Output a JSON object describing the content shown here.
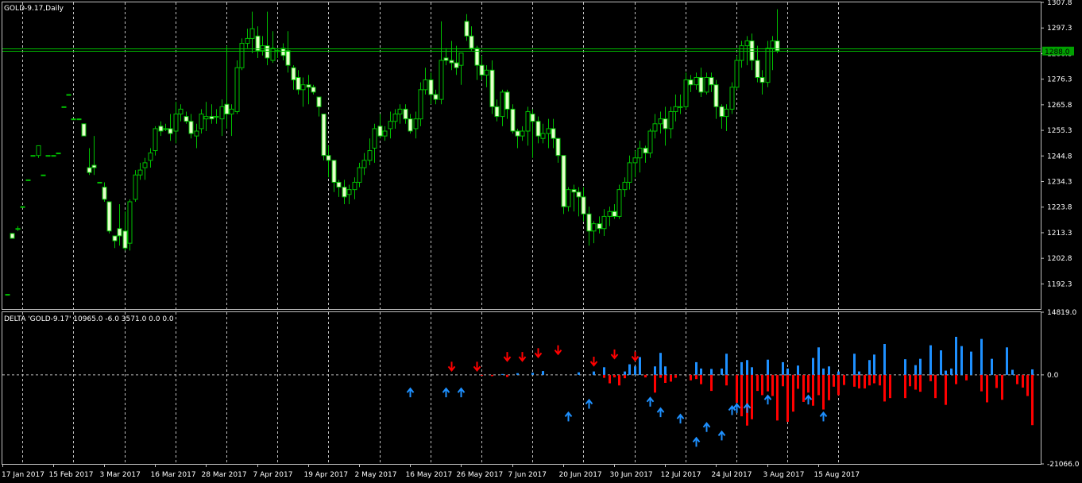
{
  "chart_data": [
    {
      "type": "candlestick",
      "title": "GOLD-9.17,Daily",
      "colors": {
        "background": "#000000",
        "grid": "#c0c0c0",
        "up": "#00c000",
        "body_up": "#000000",
        "body_down": "#e6ffcc",
        "bid_line": "#00c000",
        "price_tag": "#00a000"
      },
      "grid": true,
      "ylim": [
        1182.0,
        1307.8
      ],
      "y_ticks": [
        "1307.8",
        "1297.3",
        "1286.8",
        "1276.3",
        "1265.8",
        "1255.3",
        "1244.8",
        "1234.3",
        "1223.8",
        "1213.3",
        "1202.8",
        "1192.3"
      ],
      "current_price_label": "1288.0",
      "current_price": 1288.0,
      "bid_line": 1289.0,
      "x_ticks": [
        "17 Jan 2017",
        "15 Feb 2017",
        "3 Mar 2017",
        "16 Mar 2017",
        "28 Mar 2017",
        "7 Apr 2017",
        "19 Apr 2017",
        "2 May 2017",
        "16 May 2017",
        "26 May 2017",
        "7 Jun 2017",
        "20 Jun 2017",
        "30 Jun 2017",
        "12 Jul 2017",
        "24 Jul 2017",
        "3 Aug 2017",
        "15 Aug 2017"
      ],
      "candles": [
        [
          1188,
          1188,
          1188,
          1188
        ],
        [
          1213,
          1213,
          1211,
          1211
        ],
        [
          1215,
          1216,
          1214,
          1215
        ],
        [
          1224,
          1224,
          1224,
          1224
        ],
        [
          1235,
          1235,
          1235,
          1235
        ],
        [
          1245,
          1245,
          1245,
          1245
        ],
        [
          1245,
          1249,
          1244,
          1249
        ],
        [
          1237,
          1237,
          1237,
          1237
        ],
        [
          1245,
          1245,
          1245,
          1245
        ],
        [
          1245,
          1245,
          1245,
          1245
        ],
        [
          1246,
          1246,
          1246,
          1246
        ],
        [
          1265,
          1265,
          1265,
          1265
        ],
        [
          1270,
          1270,
          1270,
          1270
        ],
        [
          1260,
          1260,
          1260,
          1260
        ],
        [
          1260,
          1260,
          1260,
          1260
        ],
        [
          1258,
          1258,
          1253,
          1253
        ],
        [
          1240,
          1248,
          1237,
          1238
        ],
        [
          1241,
          1253,
          1237,
          1240
        ],
        [
          1234,
          1234,
          1234,
          1234
        ],
        [
          1232,
          1234,
          1226,
          1227
        ],
        [
          1226,
          1226,
          1213,
          1214
        ],
        [
          1212,
          1212,
          1207,
          1210
        ],
        [
          1215,
          1225,
          1208,
          1212
        ],
        [
          1214,
          1222,
          1206,
          1207
        ],
        [
          1209,
          1227,
          1206,
          1226
        ],
        [
          1227,
          1239,
          1226,
          1237
        ],
        [
          1237,
          1242,
          1235,
          1239
        ],
        [
          1240,
          1244,
          1235,
          1242
        ],
        [
          1243,
          1248,
          1240,
          1246
        ],
        [
          1247,
          1257,
          1245,
          1256
        ],
        [
          1257,
          1259,
          1253,
          1255
        ],
        [
          1256,
          1258,
          1255,
          1256
        ],
        [
          1256,
          1262,
          1251,
          1254
        ],
        [
          1255,
          1267,
          1250,
          1262
        ],
        [
          1262,
          1266,
          1259,
          1264
        ],
        [
          1261,
          1263,
          1258,
          1259
        ],
        [
          1259,
          1262,
          1252,
          1254
        ],
        [
          1253,
          1258,
          1248,
          1255
        ],
        [
          1256,
          1264,
          1254,
          1262
        ],
        [
          1260,
          1267,
          1255,
          1261
        ],
        [
          1261,
          1266,
          1258,
          1260
        ],
        [
          1261,
          1264,
          1258,
          1261
        ],
        [
          1260,
          1268,
          1253,
          1265
        ],
        [
          1266,
          1290,
          1256,
          1262
        ],
        [
          1262,
          1266,
          1253,
          1264
        ],
        [
          1263,
          1284,
          1262,
          1281
        ],
        [
          1281,
          1293,
          1280,
          1291
        ],
        [
          1291,
          1297,
          1289,
          1293
        ],
        [
          1293,
          1304,
          1287,
          1297
        ],
        [
          1294,
          1298,
          1285,
          1288
        ],
        [
          1288,
          1294,
          1286,
          1290
        ],
        [
          1290,
          1304,
          1282,
          1285
        ],
        [
          1284,
          1296,
          1283,
          1289
        ],
        [
          1288,
          1289,
          1285,
          1288
        ],
        [
          1289,
          1291,
          1284,
          1286
        ],
        [
          1288,
          1296,
          1279,
          1282
        ],
        [
          1281,
          1282,
          1272,
          1276
        ],
        [
          1277,
          1280,
          1270,
          1272
        ],
        [
          1272,
          1277,
          1265,
          1274
        ],
        [
          1274,
          1278,
          1266,
          1273
        ],
        [
          1273,
          1274,
          1270,
          1271
        ],
        [
          1269,
          1269,
          1261,
          1265
        ],
        [
          1262,
          1262,
          1243,
          1245
        ],
        [
          1245,
          1249,
          1236,
          1243
        ],
        [
          1243,
          1243,
          1230,
          1234
        ],
        [
          1234,
          1235,
          1228,
          1232
        ],
        [
          1232,
          1235,
          1225,
          1228
        ],
        [
          1229,
          1233,
          1225,
          1231
        ],
        [
          1231,
          1236,
          1227,
          1234
        ],
        [
          1234,
          1242,
          1232,
          1240
        ],
        [
          1240,
          1246,
          1237,
          1243
        ],
        [
          1243,
          1252,
          1241,
          1247
        ],
        [
          1248,
          1258,
          1242,
          1256
        ],
        [
          1257,
          1262,
          1252,
          1253
        ],
        [
          1253,
          1257,
          1251,
          1255
        ],
        [
          1256,
          1263,
          1252,
          1259
        ],
        [
          1259,
          1264,
          1256,
          1262
        ],
        [
          1262,
          1266,
          1258,
          1264
        ],
        [
          1264,
          1266,
          1258,
          1260
        ],
        [
          1260,
          1262,
          1254,
          1255
        ],
        [
          1256,
          1263,
          1252,
          1260
        ],
        [
          1260,
          1275,
          1257,
          1272
        ],
        [
          1272,
          1281,
          1270,
          1276
        ],
        [
          1276,
          1279,
          1266,
          1270
        ],
        [
          1270,
          1272,
          1266,
          1268
        ],
        [
          1268,
          1300,
          1266,
          1284
        ],
        [
          1285,
          1289,
          1282,
          1284
        ],
        [
          1284,
          1292,
          1280,
          1283
        ],
        [
          1283,
          1290,
          1278,
          1281
        ],
        [
          1282,
          1287,
          1274,
          1287
        ],
        [
          1300,
          1303,
          1292,
          1294
        ],
        [
          1294,
          1298,
          1288,
          1289
        ],
        [
          1289,
          1290,
          1276,
          1282
        ],
        [
          1282,
          1286,
          1276,
          1278
        ],
        [
          1278,
          1282,
          1273,
          1280
        ],
        [
          1280,
          1284,
          1262,
          1265
        ],
        [
          1265,
          1268,
          1259,
          1261
        ],
        [
          1261,
          1272,
          1257,
          1271
        ],
        [
          1271,
          1272,
          1260,
          1264
        ],
        [
          1264,
          1266,
          1254,
          1255
        ],
        [
          1255,
          1256,
          1248,
          1253
        ],
        [
          1253,
          1257,
          1251,
          1255
        ],
        [
          1255,
          1265,
          1249,
          1263
        ],
        [
          1262,
          1264,
          1244,
          1259
        ],
        [
          1259,
          1261,
          1250,
          1253
        ],
        [
          1252,
          1258,
          1250,
          1254
        ],
        [
          1254,
          1260,
          1248,
          1256
        ],
        [
          1256,
          1260,
          1248,
          1252
        ],
        [
          1252,
          1252,
          1242,
          1245
        ],
        [
          1245,
          1245,
          1221,
          1224
        ],
        [
          1224,
          1232,
          1222,
          1231
        ],
        [
          1231,
          1233,
          1222,
          1230
        ],
        [
          1230,
          1232,
          1220,
          1228
        ],
        [
          1228,
          1232,
          1218,
          1221
        ],
        [
          1221,
          1224,
          1208,
          1214
        ],
        [
          1214,
          1218,
          1209,
          1217
        ],
        [
          1217,
          1220,
          1213,
          1215
        ],
        [
          1215,
          1223,
          1212,
          1220
        ],
        [
          1220,
          1224,
          1216,
          1222
        ],
        [
          1222,
          1225,
          1219,
          1220
        ],
        [
          1220,
          1233,
          1219,
          1231
        ],
        [
          1231,
          1236,
          1228,
          1234
        ],
        [
          1234,
          1245,
          1231,
          1242
        ],
        [
          1242,
          1247,
          1236,
          1244
        ],
        [
          1244,
          1251,
          1238,
          1248
        ],
        [
          1248,
          1249,
          1242,
          1246
        ],
        [
          1246,
          1256,
          1244,
          1255
        ],
        [
          1255,
          1262,
          1252,
          1258
        ],
        [
          1258,
          1263,
          1254,
          1260
        ],
        [
          1260,
          1265,
          1249,
          1256
        ],
        [
          1256,
          1265,
          1252,
          1263
        ],
        [
          1263,
          1270,
          1259,
          1265
        ],
        [
          1265,
          1270,
          1262,
          1265
        ],
        [
          1265,
          1279,
          1264,
          1276
        ],
        [
          1276,
          1278,
          1271,
          1274
        ],
        [
          1274,
          1279,
          1272,
          1277
        ],
        [
          1277,
          1281,
          1269,
          1271
        ],
        [
          1271,
          1279,
          1270,
          1277
        ],
        [
          1277,
          1279,
          1271,
          1274
        ],
        [
          1274,
          1276,
          1260,
          1265
        ],
        [
          1265,
          1266,
          1256,
          1261
        ],
        [
          1261,
          1266,
          1255,
          1264
        ],
        [
          1264,
          1275,
          1262,
          1273
        ],
        [
          1273,
          1286,
          1272,
          1284
        ],
        [
          1284,
          1292,
          1281,
          1290
        ],
        [
          1290,
          1294,
          1282,
          1292
        ],
        [
          1292,
          1295,
          1280,
          1284
        ],
        [
          1284,
          1290,
          1275,
          1277
        ],
        [
          1277,
          1280,
          1270,
          1275
        ],
        [
          1275,
          1292,
          1273,
          1289
        ],
        [
          1289,
          1294,
          1280,
          1292
        ],
        [
          1292,
          1305,
          1287,
          1288
        ]
      ]
    },
    {
      "type": "bar",
      "title": "DELTA 'GOLD-9.17' 10965.0 -6.0 3571.0 0.0 0.0",
      "colors": {
        "positive": "#1e90ff",
        "negative": "#ff0000",
        "arrow_up": "#1e90ff",
        "arrow_down": "#ff0000"
      },
      "ylim": [
        -21066.0,
        14819.0
      ],
      "y_ticks": [
        "14819.0",
        "0.0",
        "-21066.0"
      ],
      "first_index": 91,
      "positive": [
        0,
        0,
        0,
        0,
        0,
        0,
        200,
        0,
        0,
        400,
        0,
        0,
        500,
        0,
        900,
        0,
        0,
        0,
        0,
        0,
        0,
        600,
        0,
        0,
        800,
        0,
        1800,
        0,
        0,
        0,
        800,
        2500,
        2000,
        4200,
        0,
        0,
        2000,
        5200,
        2000,
        0,
        0,
        0,
        0,
        0,
        3000,
        1500,
        0,
        1400,
        0,
        1500,
        5000,
        0,
        0,
        3000,
        3500,
        1800,
        0,
        0,
        3600,
        0,
        0,
        3000,
        1500,
        0,
        2200,
        0,
        0,
        4000,
        6500,
        1500,
        2000,
        0,
        800,
        0,
        0,
        5000,
        800,
        0,
        3500,
        4800,
        0,
        7300,
        0,
        0,
        0,
        3700,
        0,
        2300,
        3800,
        0,
        7000,
        0,
        5800,
        1000,
        1500,
        9000,
        6800,
        0,
        5500,
        0,
        8500,
        0,
        3800,
        0,
        0,
        6500,
        1200,
        0,
        0,
        0,
        1300
      ],
      "negative": [
        0,
        0,
        -200,
        0,
        -300,
        0,
        0,
        -500,
        0,
        0,
        0,
        0,
        0,
        0,
        0,
        0,
        0,
        0,
        0,
        0,
        0,
        0,
        0,
        0,
        0,
        0,
        -700,
        -2000,
        -600,
        -2500,
        -800,
        0,
        0,
        0,
        -600,
        0,
        -4200,
        -700,
        -1900,
        -1600,
        -700,
        0,
        0,
        -1300,
        -1000,
        -2200,
        0,
        -3800,
        0,
        0,
        -2500,
        0,
        -6600,
        -9800,
        -12000,
        -10500,
        -3800,
        -4800,
        -3900,
        -5000,
        -10800,
        -2700,
        -11100,
        -8700,
        -3300,
        -6400,
        -4200,
        -7300,
        -4800,
        -8200,
        -6000,
        -2800,
        -4800,
        -2400,
        0,
        -2800,
        -3200,
        -3200,
        -2500,
        -2000,
        -2500,
        -6300,
        -5500,
        0,
        0,
        -5500,
        -2700,
        -3500,
        -4000,
        0,
        -1500,
        -5500,
        0,
        -7100,
        0,
        -2200,
        0,
        -1300,
        0,
        0,
        -3900,
        -6500,
        0,
        -3100,
        -5900,
        0,
        0,
        -2200,
        -3000,
        -5000,
        -11900,
        0,
        0
      ]
    }
  ]
}
